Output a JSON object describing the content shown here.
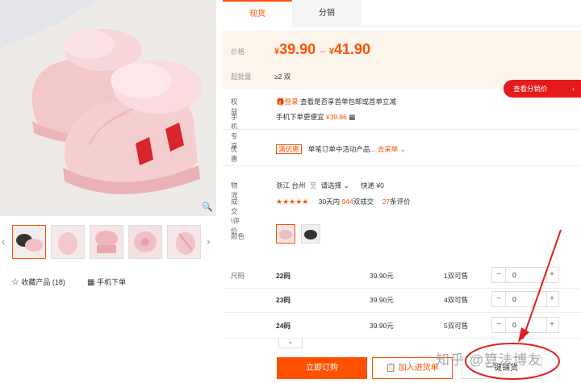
{
  "tabs": [
    "现货",
    "分销"
  ],
  "price": {
    "label": "价格",
    "currency": "¥",
    "low": "39.90",
    "range_sep": "--",
    "high": "41.90",
    "moq_label": "起批量",
    "moq": "≥2 双"
  },
  "distribution_button": "查看分销价",
  "benefits": {
    "label": "权益",
    "tag": "登录",
    "text": "查看是否享首单包邮或首单立减"
  },
  "mobile": {
    "label": "手机专享",
    "text": "手机下单更便宜",
    "price": "¥39.86"
  },
  "promo": {
    "label": "优惠",
    "tag": "满优惠",
    "text": "单笔订单中活动产品...",
    "link": "去采单"
  },
  "logistics": {
    "label": "物流",
    "from": "浙江 台州",
    "to_word": "至",
    "to": "请选择",
    "shipping": "快递 ¥0"
  },
  "sales": {
    "label": "成交\\评价",
    "stars": "★★★★★",
    "prefix": "30天内",
    "count": "944",
    "unit": "双成交",
    "reviews": "27",
    "reviews_unit": "条评价"
  },
  "color_label": "颜色",
  "size_label": "尺码",
  "sizes": [
    {
      "size": "22码",
      "price": "39.90元",
      "avail": "1双可售",
      "qty": "0"
    },
    {
      "size": "23码",
      "price": "39.90元",
      "avail": "4双可售",
      "qty": "0"
    },
    {
      "size": "24码",
      "price": "39.90元",
      "avail": "5双可售",
      "qty": "0"
    }
  ],
  "more_chevron": "⌄",
  "actions": {
    "buy": "立即订购",
    "cart": "加入进货单",
    "distribute": "一键铺货"
  },
  "left": {
    "favorite": "收藏产品",
    "favorite_count": "(18)",
    "mobile_order": "手机下单"
  },
  "watermark": "知乎 @算法博友",
  "colors": {
    "accent": "#ff5000",
    "red": "#e61a1a",
    "price_bg": "#fdf4ec"
  }
}
